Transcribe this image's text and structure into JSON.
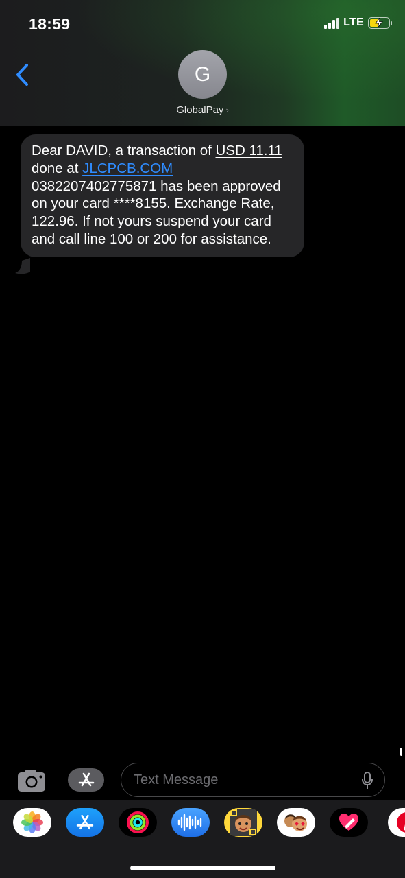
{
  "status_bar": {
    "time": "18:59",
    "network": "LTE",
    "battery_state": "charging",
    "battery_color": "#f5d60e"
  },
  "header": {
    "back_icon": "chevron-left-icon",
    "avatar_initial": "G",
    "contact_name": "GlobalPay",
    "contact_chevron": "›"
  },
  "message": {
    "seg1": "Dear DAVID, a transaction of ",
    "amount": "USD 11.11",
    "seg2": " done at ",
    "merchant_link": "JLCPCB.COM",
    "seg3": " 0382207402775871 has been approved on your card ****8155. Exchange Rate, 122.96. If not yours suspend your card and call line 100 or 200 for assistance.",
    "bubble_color": "#262628",
    "link_color": "#2f8cff"
  },
  "input_bar": {
    "placeholder": "Text Message",
    "camera_icon": "camera-icon",
    "apps_icon": "app-store-icon",
    "mic_icon": "microphone-icon"
  },
  "app_drawer": {
    "apps": [
      "photos-icon",
      "app-store-icon",
      "activity-rings-icon",
      "audio-message-icon",
      "memoji-icon",
      "memoji-stickers-icon",
      "digital-touch-icon",
      "pinterest-icon"
    ]
  }
}
